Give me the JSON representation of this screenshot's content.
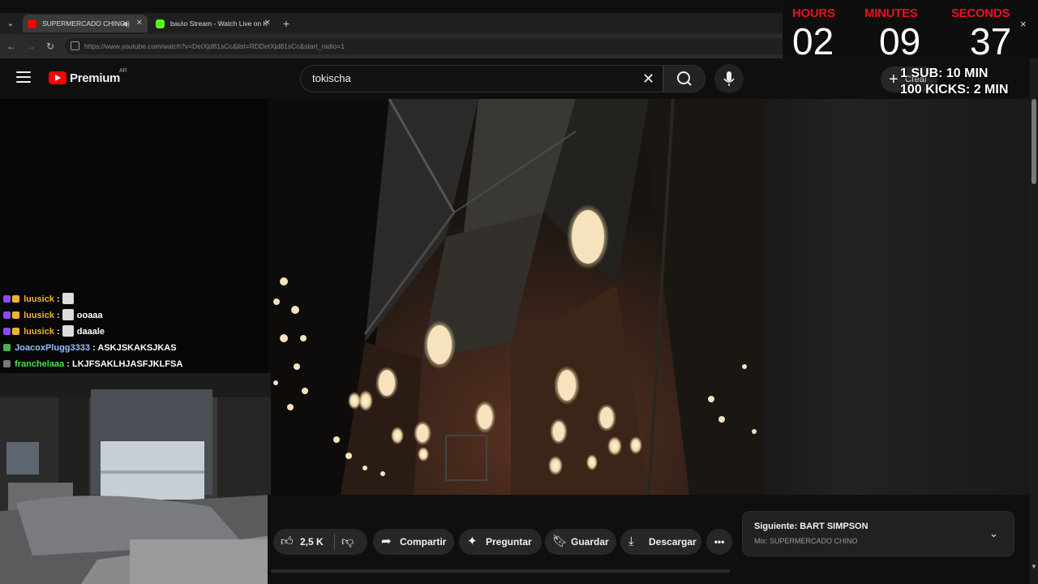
{
  "browser": {
    "tabs": [
      {
        "title": "SUPERMERCADO CHINO -",
        "favicon_color": "#ff0000",
        "audio": true
      },
      {
        "title": "bau\\o Stream - Watch Live on K",
        "favicon_color": "#53fc18"
      }
    ],
    "new_tab": "+",
    "url": "https://www.youtube.com/watch?v=DetXjd81sCc&list=RDDetXjd81sCc&start_radio=1"
  },
  "youtube": {
    "brand": "Premium",
    "region": "AR",
    "search_query": "tokischa",
    "create_label": "Crear",
    "actions": {
      "likes": "2,5 K",
      "share": "Compartir",
      "ask": "Preguntar",
      "save": "Guardar",
      "download": "Descargar"
    },
    "up_next": {
      "title": "Siguiente: BART SIMPSON",
      "subtitle": "Mix: SUPERMERCADO CHINO"
    }
  },
  "timer": {
    "labels": {
      "hours": "HOURS",
      "minutes": "MINUTES",
      "seconds": "SECONDS"
    },
    "values": {
      "hours": "02",
      "minutes": "09",
      "seconds": "37"
    },
    "close": "×"
  },
  "subathon_rules": [
    "1 SUB: 10 MIN",
    "100 KICKS: 2 MIN"
  ],
  "chat": [
    {
      "user": "luusick",
      "message": "",
      "color": "gold"
    },
    {
      "user": "luusick",
      "message": "ooaaa",
      "color": "gold"
    },
    {
      "user": "luusick",
      "message": "daaale",
      "color": "gold"
    },
    {
      "user": "JoacoxPlugg3333",
      "message": "ASKJSKAKSJKAS",
      "color": "blue"
    },
    {
      "user": "franchelaaa",
      "message": "LKJFSAKLHJASFJKLFSA",
      "color": "green"
    }
  ],
  "colors": {
    "accent": "#ff0000",
    "timer_label": "#e8121b",
    "kick": "#53fc18"
  }
}
